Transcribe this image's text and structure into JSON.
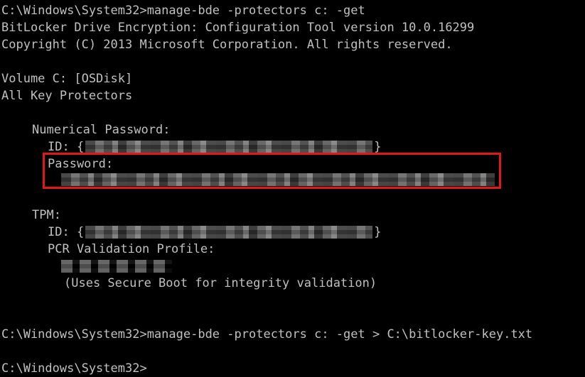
{
  "console": {
    "line1": "C:\\Windows\\System32>manage-bde -protectors c: -get",
    "line2": "BitLocker Drive Encryption: Configuration Tool version 10.0.16299",
    "line3": "Copyright (C) 2013 Microsoft Corporation. All rights reserved.",
    "volume": "Volume C: [OSDisk]",
    "all_protectors": "All Key Protectors",
    "numerical_password_heading": "Numerical Password:",
    "id_prefix": "ID: {",
    "id_suffix": "}",
    "password_label": "Password:",
    "tpm_heading": "TPM:",
    "tpm_id_prefix": "ID: {",
    "tpm_id_suffix": "}",
    "pcr_label": "PCR Validation Profile:",
    "pcr_note": "(Uses Secure Boot for integrity validation)",
    "command2": "C:\\Windows\\System32>manage-bde -protectors c: -get > C:\\bitlocker-key.txt",
    "prompt": "C:\\Windows\\System32>"
  },
  "colors": {
    "background": "#000000",
    "text": "#c0c0c0",
    "highlight_border": "#e01818"
  }
}
